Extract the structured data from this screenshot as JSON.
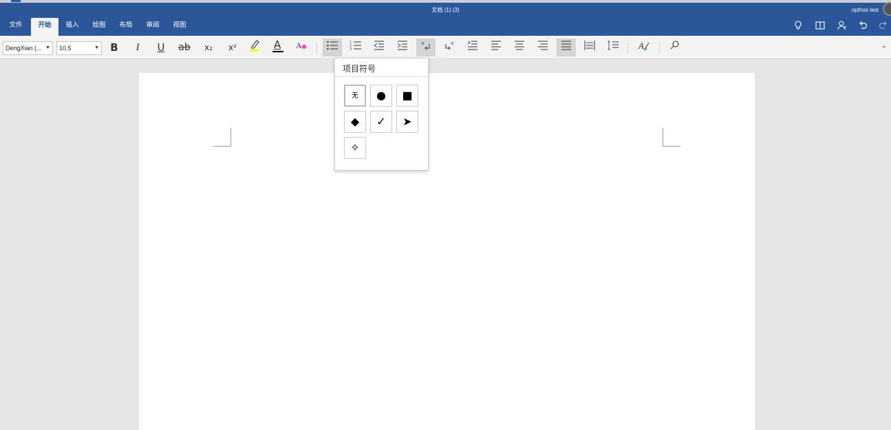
{
  "titlebar": {
    "doc_title": "文档 (1) (3)",
    "user_name": "opthos test"
  },
  "tabs": [
    "文件",
    "开始",
    "插入",
    "绘图",
    "布局",
    "审阅",
    "视图"
  ],
  "active_tab": "开始",
  "header_icons": [
    "lightbulb-icon",
    "reading-view-icon",
    "share-person-icon",
    "undo-icon",
    "redo-icon"
  ],
  "ribbon": {
    "font_name": "DengXian (...",
    "font_size": "10.5",
    "bold": "B",
    "italic": "I",
    "underline": "U",
    "strikethrough": "ab",
    "subscript": "x₂",
    "superscript": "x²",
    "font_color": "A"
  },
  "bullet_menu": {
    "title": "项目符号",
    "options": [
      {
        "name": "none",
        "glyph": "无"
      },
      {
        "name": "circle",
        "glyph": "●"
      },
      {
        "name": "square",
        "glyph": "■"
      },
      {
        "name": "diamond",
        "glyph": "◆"
      },
      {
        "name": "check",
        "glyph": "✓"
      },
      {
        "name": "arrow",
        "glyph": "➤"
      },
      {
        "name": "star",
        "glyph": "✧"
      }
    ],
    "selected": "none"
  },
  "colors": {
    "brand": "#2b579a",
    "ribbon_bg": "#f3f3f3",
    "canvas_bg": "#e6e6e6",
    "highlight": "#ffff00",
    "font_color_bar": "#000000"
  }
}
